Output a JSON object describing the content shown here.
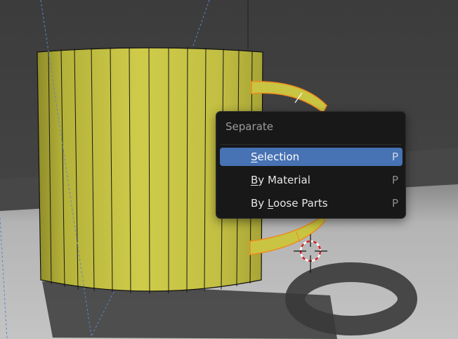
{
  "colors": {
    "mug_body": "#c9c542",
    "mug_edge": "#111111",
    "selection_orange": "#f08a1c",
    "menu_bg": "#181818",
    "menu_highlight": "#4772b3",
    "floor": "#bcbcbc",
    "background": "#3a3a3a"
  },
  "scene": {
    "objects": [
      "mug-body",
      "mug-handle",
      "3d-cursor",
      "camera-frustum-lines"
    ]
  },
  "menu": {
    "title": "Separate",
    "items": [
      {
        "pre": "",
        "key": "S",
        "post": "election",
        "shortcut": "P",
        "active": true
      },
      {
        "pre": "",
        "key": "B",
        "post": "y Material",
        "shortcut": "P",
        "active": false
      },
      {
        "pre": "By ",
        "key": "L",
        "post": "oose Parts",
        "shortcut": "P",
        "active": false
      }
    ]
  }
}
